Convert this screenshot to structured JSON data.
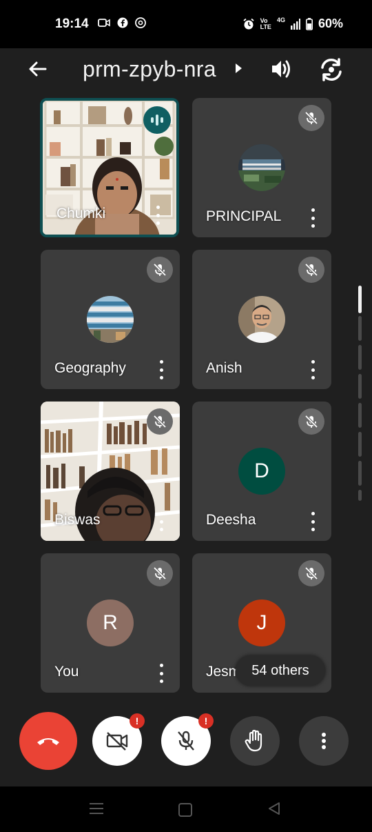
{
  "status_bar": {
    "time": "19:14",
    "left_icons": [
      "video-call-icon",
      "facebook-icon",
      "chrome-icon"
    ],
    "right_icons": [
      "alarm-icon",
      "volte-icon",
      "signal-icon",
      "battery-icon"
    ],
    "volte_label_1": "Vo",
    "volte_label_2": "LTE",
    "network": "4G",
    "battery": "60%"
  },
  "header": {
    "meeting_code": "prm-zpyb-nra"
  },
  "participants": [
    {
      "name": "Chumki",
      "type": "video",
      "speaking": true,
      "muted": false
    },
    {
      "name": "PRINCIPAL",
      "type": "photo",
      "muted": true
    },
    {
      "name": "Geography",
      "type": "photo",
      "muted": true
    },
    {
      "name": "Anish",
      "type": "photo",
      "muted": true
    },
    {
      "name": "Biswas",
      "type": "video",
      "muted": true
    },
    {
      "name": "Deesha",
      "type": "initial",
      "initial": "D",
      "color": "#004d40",
      "muted": true
    },
    {
      "name": "You",
      "type": "initial",
      "initial": "R",
      "color": "#8d6e63",
      "muted": true
    },
    {
      "name": "Jesmi",
      "type": "initial",
      "initial": "J",
      "color": "#bf360c",
      "muted": true
    }
  ],
  "others_label": "54 others",
  "controls": {
    "end_call": "end-call-icon",
    "camera": "camera-off-icon",
    "camera_alert": "!",
    "mic": "mic-off-icon",
    "mic_alert": "!",
    "raise_hand": "raise-hand-icon",
    "more": "more-options-icon"
  },
  "colors": {
    "background": "#1f1f1f",
    "tile": "#3c3c3c",
    "end_call": "#ea4335",
    "active_border": "#0f4f52"
  }
}
